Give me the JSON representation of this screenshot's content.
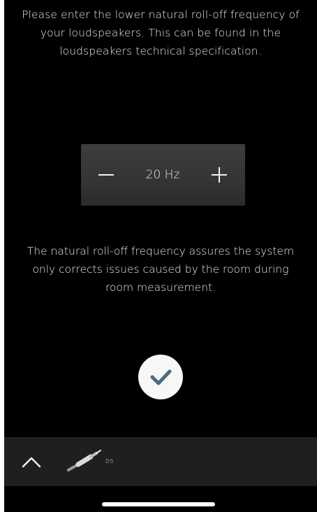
{
  "setup": {
    "instruction": "Please enter the lower natural roll-off frequency of your loudspeakers. This can be found in the loudspeakers technical specification.",
    "explanation": "The natural roll-off frequency assures the system only corrects issues caused by the room during room measurement."
  },
  "frequency": {
    "value": "20 Hz",
    "decrement_icon": "minus-icon",
    "increment_icon": "plus-icon"
  },
  "confirm": {
    "icon": "checkmark-icon",
    "icon_color": "#4e6a78"
  },
  "bottom_bar": {
    "expand_icon": "chevron-up-icon",
    "device_icon": "cable-icon",
    "device_label": "D5"
  }
}
